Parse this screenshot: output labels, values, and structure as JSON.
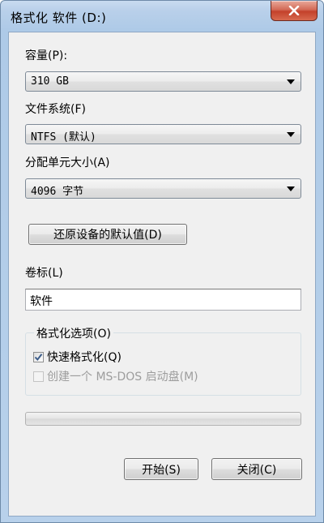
{
  "window": {
    "title": "格式化 软件 (D:)",
    "close_icon": "close-x-icon"
  },
  "capacity": {
    "label": "容量(P):",
    "value": "310 GB"
  },
  "filesystem": {
    "label": "文件系统(F)",
    "value": "NTFS (默认)"
  },
  "allocation": {
    "label": "分配单元大小(A)",
    "value": "4096 字节"
  },
  "restore_defaults": {
    "label": "还原设备的默认值(D)"
  },
  "volume_label": {
    "label": "卷标(L)",
    "value": "软件"
  },
  "format_options": {
    "legend": "格式化选项(O)",
    "quick_format": {
      "label": "快速格式化(Q)",
      "checked": true
    },
    "msdos_startup": {
      "label": "创建一个 MS-DOS 启动盘(M)",
      "checked": false,
      "disabled": true
    }
  },
  "progress": {
    "value": 0
  },
  "buttons": {
    "start": "开始(S)",
    "close": "关闭(C)"
  },
  "colors": {
    "titlebar": "#b9d0ea",
    "close_button": "#c3412b",
    "client_bg": "#f0f0f0"
  }
}
